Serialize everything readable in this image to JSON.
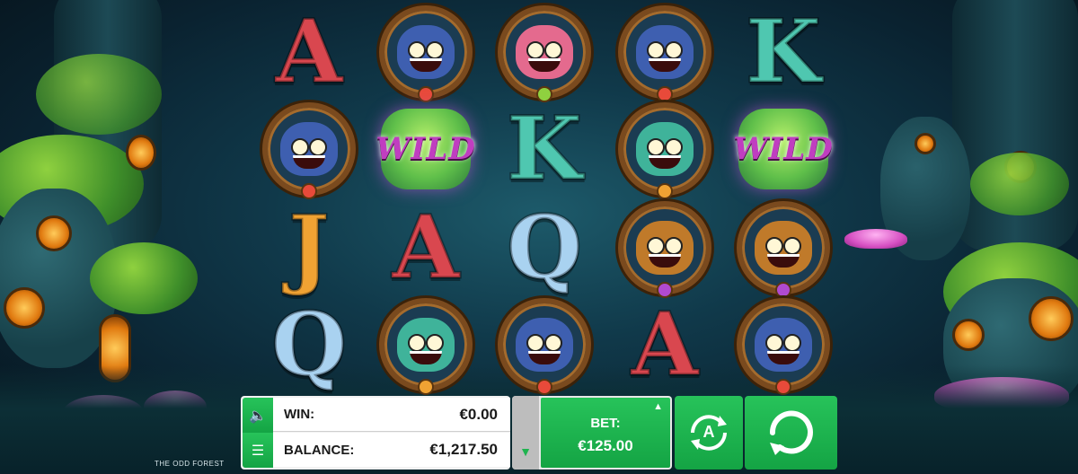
{
  "game": {
    "title": "THE ODD FOREST",
    "wild_label": "WILD"
  },
  "reels": [
    [
      "A",
      "troll-blue",
      "J",
      "Q"
    ],
    [
      "troll-blue",
      "WILD",
      "A",
      "troll-red"
    ],
    [
      "fairy",
      "K",
      "Q",
      "troll-blue"
    ],
    [
      "troll-blue",
      "troll-red",
      "troll-purple",
      "A"
    ],
    [
      "K",
      "WILD",
      "troll-purple",
      "troll-blue"
    ]
  ],
  "controls": {
    "win_label": "WIN:",
    "win_value": "€0.00",
    "balance_label": "BALANCE:",
    "balance_value": "€1,217.50",
    "bet_label": "BET:",
    "bet_value": "€125.00",
    "autoplay_letter": "A"
  },
  "colors": {
    "accent_green": "#1fb34f",
    "letter_A": "#d9474f",
    "letter_K": "#4fc7b0",
    "letter_J": "#f0a233",
    "letter_Q": "#a9d2f0"
  },
  "icons": {
    "sound": "speaker-muted-icon",
    "menu": "menu-list-icon",
    "bet_up": "chevron-up-icon",
    "bet_down": "chevron-down-icon",
    "autoplay": "autoplay-icon",
    "spin": "spin-icon"
  }
}
